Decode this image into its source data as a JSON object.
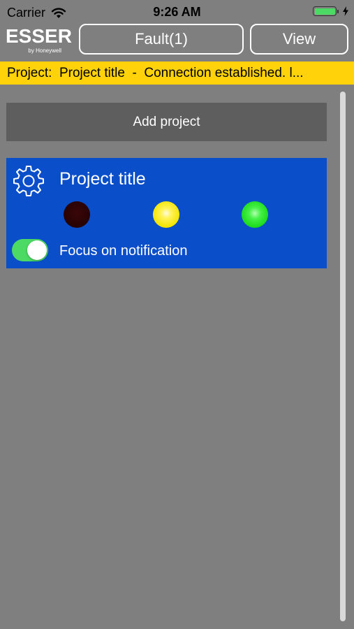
{
  "status_bar": {
    "carrier": "Carrier",
    "time": "9:26 AM"
  },
  "header": {
    "logo_main": "ESSER",
    "logo_sub": "by Honeywell",
    "fault_label": "Fault(1)",
    "view_label": "View"
  },
  "ticker": {
    "text": "Project:  Project title  -  Connection established. l..."
  },
  "add_project": {
    "label": "Add project"
  },
  "project_card": {
    "title": "Project title",
    "toggle_label": "Focus on notification",
    "toggle_on": true
  },
  "colors": {
    "background": "#7f7f7f",
    "ticker": "#ffd20a",
    "card": "#0a4fc9",
    "add_button": "#5e5e5e",
    "toggle_on": "#4cd964",
    "lamp_red": "#2a0304",
    "lamp_yellow": "#f4e400",
    "lamp_green": "#17d817"
  },
  "icons": {
    "wifi": "wifi-icon",
    "battery": "battery-icon",
    "charging": "bolt-icon",
    "settings": "gear-icon"
  }
}
